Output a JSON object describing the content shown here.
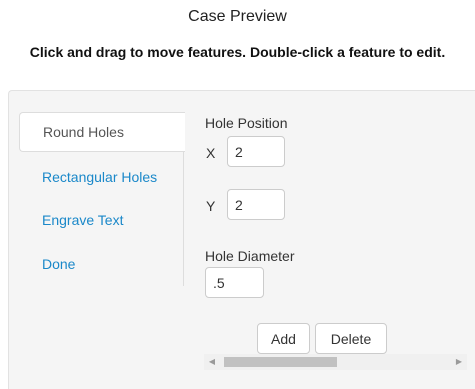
{
  "header": {
    "title": "Case Preview",
    "instructions": "Click and drag to move features. Double-click a feature to edit."
  },
  "sidebar": {
    "tabs": [
      {
        "label": "Round Holes",
        "active": true
      },
      {
        "label": "Rectangular Holes",
        "active": false
      },
      {
        "label": "Engrave Text",
        "active": false
      },
      {
        "label": "Done",
        "active": false
      }
    ]
  },
  "form": {
    "position_label": "Hole Position",
    "x_label": "X",
    "x_value": "2",
    "y_label": "Y",
    "y_value": "2",
    "diameter_label": "Hole Diameter",
    "diameter_value": ".5",
    "add_label": "Add",
    "delete_label": "Delete"
  },
  "colors": {
    "link": "#1a88c9",
    "panel_background": "#f5f5f5"
  },
  "icons": {
    "scroll_left": "◀",
    "scroll_right": "▶"
  }
}
